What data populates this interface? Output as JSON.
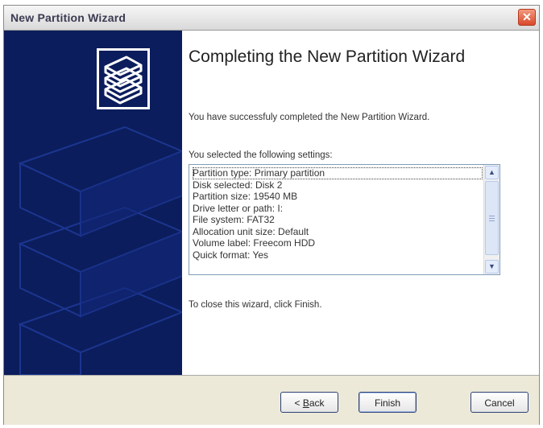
{
  "window": {
    "title": "New Partition Wizard",
    "close_glyph": "✕"
  },
  "side_panel": {
    "logo_icon": "stacked-disks-icon",
    "background_color": "#0b1d5c"
  },
  "content": {
    "heading": "Completing the New Partition Wizard",
    "success_message": "You have successfuly completed the New Partition Wizard.",
    "settings_label": "You selected the following settings:",
    "settings": [
      "Partition type: Primary partition",
      "Disk selected: Disk 2",
      "Partition size: 19540 MB",
      "Drive letter or path: I:",
      "File system: FAT32",
      "Allocation unit size: Default",
      "Volume label: Freecom HDD",
      "Quick format: Yes"
    ],
    "close_instruction": "To close this wizard, click Finish."
  },
  "buttons": {
    "back_prefix": "< ",
    "back_key": "B",
    "back_rest": "ack",
    "finish": "Finish",
    "cancel": "Cancel"
  },
  "scrollbar": {
    "up_glyph": "▲",
    "down_glyph": "▼"
  }
}
